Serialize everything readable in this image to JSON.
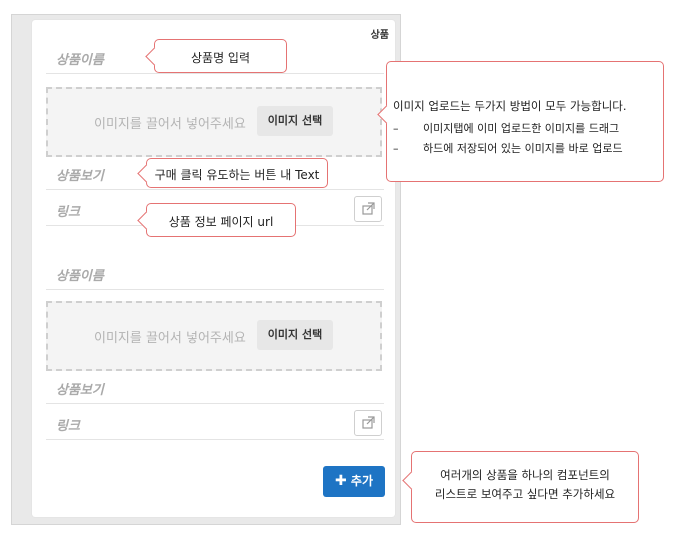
{
  "panel": {
    "title": "상품",
    "groups": [
      {
        "name_label": "상품이름",
        "dropzone_text": "이미지를 끌어서 넣어주세요",
        "select_button": "이미지 선택",
        "view_label": "상품보기",
        "link_label": "링크"
      },
      {
        "name_label": "상품이름",
        "dropzone_text": "이미지를 끌어서 넣어주세요",
        "select_button": "이미지 선택",
        "view_label": "상품보기",
        "link_label": "링크"
      }
    ],
    "add_button": "추가",
    "add_icon": "plus-icon",
    "link_icon": "external-link-icon"
  },
  "callouts": {
    "name": "상품명 입력",
    "image": {
      "title": "이미지 업로드는 두가지 방법이 모두 가능합니다.",
      "bullets": [
        "이미지탭에 이미 업로드한 이미지를 드래그",
        "하드에 저장되어 있는 이미지를 바로 업로드"
      ],
      "bullet_mark": "–"
    },
    "view": "구매 클릭 유도하는 버튼 내 Text",
    "link": "상품 정보 페이지 url",
    "add": {
      "line1": "여러개의 상품을 하나의 컴포넌트의",
      "line2": "리스트로 보여주고 싶다면 추가하세요"
    }
  },
  "colors": {
    "accent": "#1e74c4",
    "callout_border": "#e57373"
  }
}
